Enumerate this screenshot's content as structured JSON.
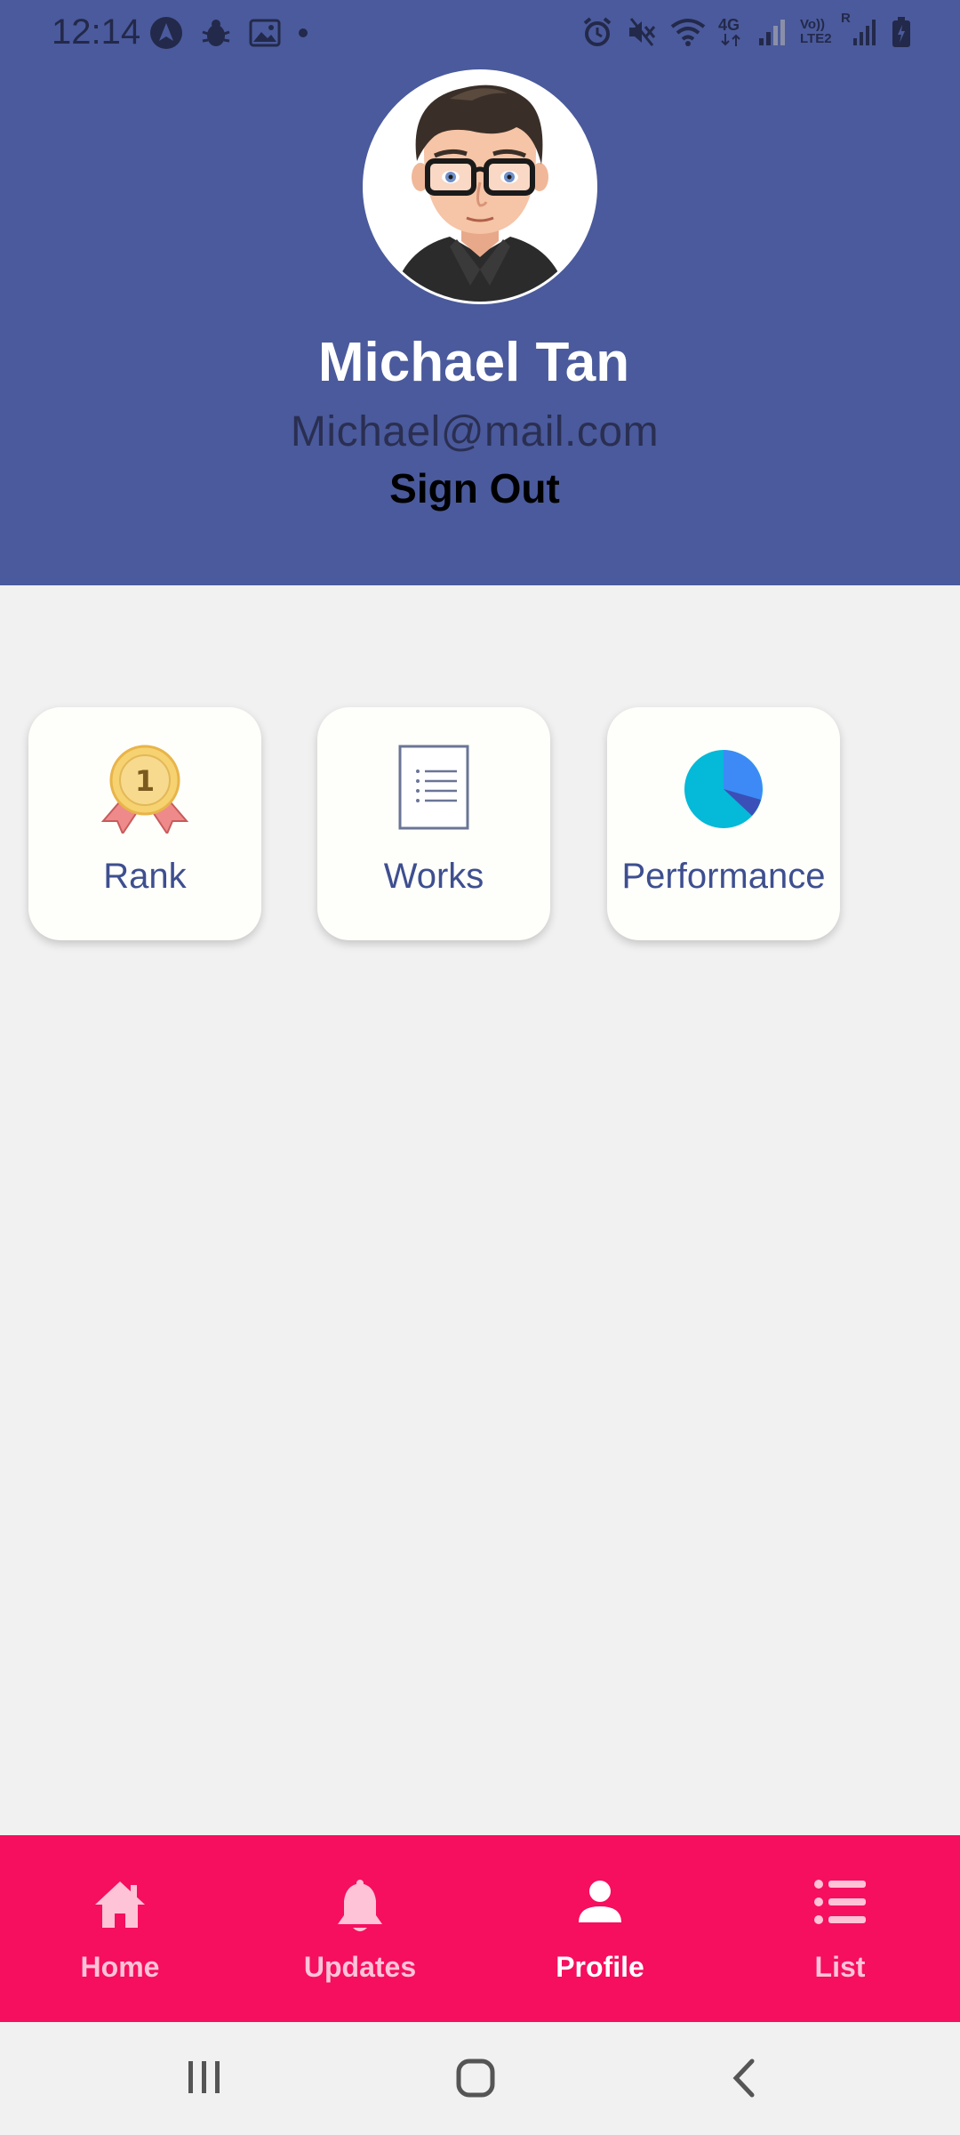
{
  "status_bar": {
    "time": "12:14",
    "left_icons": [
      "navigation-icon",
      "bug-icon",
      "image-icon",
      "dot-icon"
    ],
    "right_icons": [
      "alarm-icon",
      "mute-icon",
      "wifi-icon",
      "4g-icon",
      "signal-icon",
      "volte-icon",
      "signal-icon",
      "battery-icon"
    ],
    "network_label": "4G",
    "volte_label": "Vo)) LTE2",
    "roaming_label": "R"
  },
  "profile": {
    "name": "Michael Tan",
    "email": "Michael@mail.com",
    "sign_out_label": "Sign Out",
    "header_color": "#4a5a9c"
  },
  "cards": [
    {
      "label": "Rank",
      "icon": "medal-icon",
      "medal_number": "1"
    },
    {
      "label": "Works",
      "icon": "document-icon"
    },
    {
      "label": "Performance",
      "icon": "pie-chart-icon"
    }
  ],
  "bottom_nav": {
    "background": "#f60e5f",
    "items": [
      {
        "label": "Home",
        "icon": "home-icon",
        "active": false
      },
      {
        "label": "Updates",
        "icon": "bell-icon",
        "active": false
      },
      {
        "label": "Profile",
        "icon": "person-icon",
        "active": true
      },
      {
        "label": "List",
        "icon": "list-icon",
        "active": false
      }
    ]
  },
  "system_nav": {
    "buttons": [
      "recent-apps-icon",
      "home-circle-icon",
      "back-icon"
    ]
  }
}
